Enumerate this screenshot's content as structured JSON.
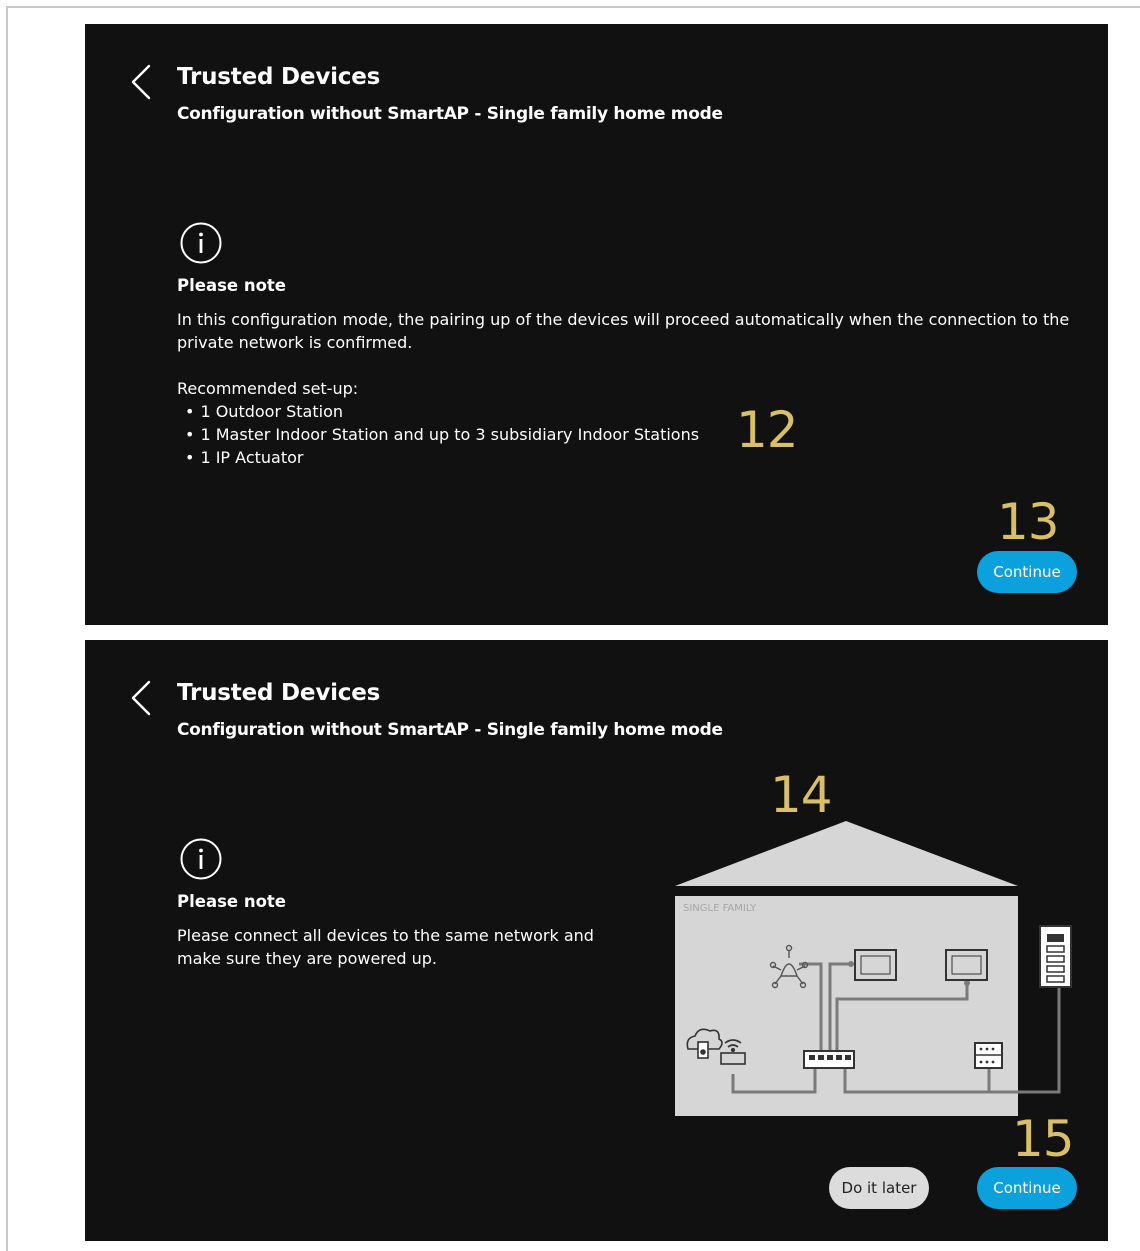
{
  "screens": [
    {
      "title": "Trusted Devices",
      "subtitle": "Configuration without SmartAP - Single family home mode",
      "note_heading": "Please note",
      "note_body": "In this configuration mode, the pairing up of the devices will proceed automatically when the connection to the private network is confirmed.",
      "setup_label": "Recommended set-up:",
      "setup_items": [
        "1 Outdoor Station",
        "1 Master Indoor Station and up to 3 subsidiary Indoor Stations",
        "1 IP Actuator"
      ],
      "callouts": [
        "12",
        "13"
      ],
      "continue_label": "Continue"
    },
    {
      "title": "Trusted Devices",
      "subtitle": "Configuration without SmartAP - Single family home mode",
      "note_heading": "Please note",
      "note_body": "Please connect all devices to the same network and make sure they are powered up.",
      "diagram_label": "SINGLE FAMILY",
      "callouts": [
        "14",
        "15"
      ],
      "later_label": "Do it later",
      "continue_label": "Continue"
    }
  ],
  "icons": {
    "back": "chevron-left-icon",
    "info": "info-circle-icon",
    "diagram": [
      "house-icon",
      "sensor-icon",
      "indoor-station-icon",
      "outdoor-station-icon",
      "cloud-icon",
      "router-icon",
      "switch-icon",
      "actuator-icon"
    ]
  },
  "colors": {
    "panel_bg": "#111111",
    "text": "#ffffff",
    "accent": "#0ca0dc",
    "callout": "#d9bf6a",
    "secondary_button": "#dcdcdc",
    "house": "#d6d6d6",
    "wire": "#7a7a7a"
  }
}
